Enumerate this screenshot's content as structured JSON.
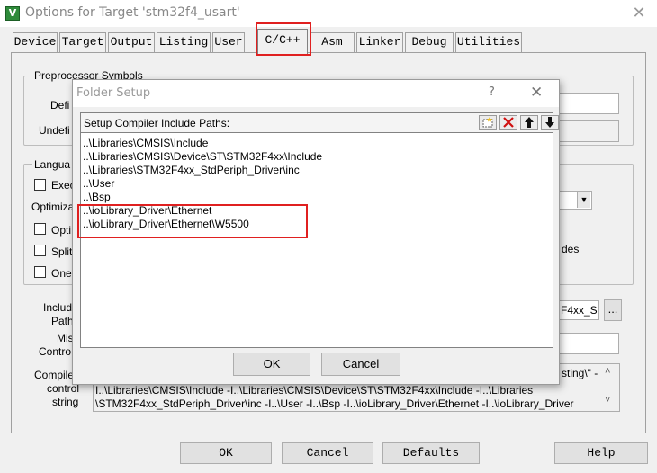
{
  "window": {
    "title": "Options for Target 'stm32f4_usart'",
    "app_icon": "V",
    "close_glyph": "✕"
  },
  "tabs": [
    {
      "label": "Device",
      "active": false
    },
    {
      "label": "Target",
      "active": false
    },
    {
      "label": "Output",
      "active": false
    },
    {
      "label": "Listing",
      "active": false
    },
    {
      "label": "User",
      "active": false
    },
    {
      "label": "C/C++",
      "active": true
    },
    {
      "label": "Asm",
      "active": false
    },
    {
      "label": "Linker",
      "active": false
    },
    {
      "label": "Debug",
      "active": false
    },
    {
      "label": "Utilities",
      "active": false
    }
  ],
  "panel": {
    "preprocessor_group": "Preprocessor Symbols",
    "define_label": "Defi",
    "undefine_label": "Undefi",
    "language_group": "Langua",
    "exec_label": "Exec",
    "optimiza_label": "Optimiza",
    "opti_label": "Opti",
    "split_label": "Split",
    "one_label": "One",
    "des_label": "des",
    "include_label_1": "Includ",
    "include_label_2": "Path",
    "misc_label_1": "Mis",
    "misc_label_2": "Contro",
    "include_value": "F4xx_S",
    "browse_label": "...",
    "compiler_label_1": "Compile",
    "compiler_label_2": "control",
    "compiler_label_3": "string",
    "compiler_line_0": "sting\\\" -",
    "compiler_line_1": "I..\\Libraries\\CMSIS\\Include -I..\\Libraries\\CMSIS\\Device\\ST\\STM32F4xx\\Include -I..\\Libraries",
    "compiler_line_2": "\\STM32F4xx_StdPeriph_Driver\\inc -I..\\User -I..\\Bsp -I..\\ioLibrary_Driver\\Ethernet -I..\\ioLibrary_Driver",
    "scroll_up": "˄",
    "scroll_down": "˅"
  },
  "buttons": {
    "ok": "OK",
    "cancel": "Cancel",
    "defaults": "Defaults",
    "help": "Help"
  },
  "dialog": {
    "title": "Folder Setup",
    "help_glyph": "?",
    "close_glyph": "✕",
    "header_label": "Setup Compiler Include Paths:",
    "paths": [
      "..\\Libraries\\CMSIS\\Include",
      "..\\Libraries\\CMSIS\\Device\\ST\\STM32F4xx\\Include",
      "..\\Libraries\\STM32F4xx_StdPeriph_Driver\\inc",
      "..\\User",
      "..\\Bsp",
      "..\\ioLibrary_Driver\\Ethernet",
      "..\\ioLibrary_Driver\\Ethernet\\W5500"
    ],
    "ok": "OK",
    "cancel": "Cancel"
  }
}
